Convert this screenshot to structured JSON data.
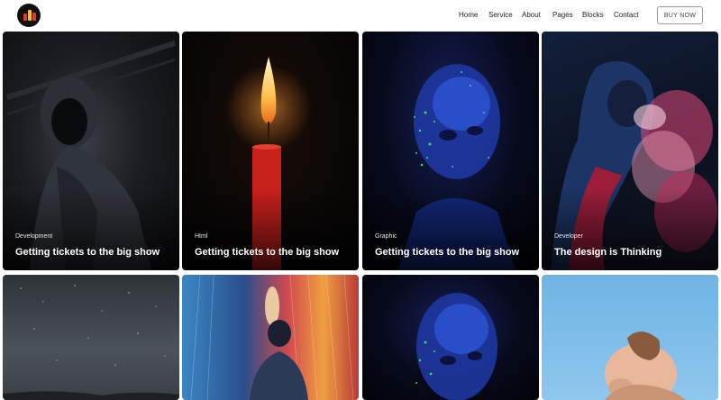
{
  "nav": {
    "items": [
      "Home",
      "Service",
      "About",
      "Pages",
      "Blocks",
      "Contact"
    ],
    "cta_label": "BUY NOW"
  },
  "cards": [
    {
      "category": "Development",
      "title": "Getting tickets to the big show"
    },
    {
      "category": "Html",
      "title": "Getting tickets to the big show"
    },
    {
      "category": "Graphic",
      "title": "Getting tickets to the big show"
    },
    {
      "category": "Developer",
      "title": "The design is Thinking"
    }
  ],
  "colors": {
    "logo_red": "#e23a2e",
    "logo_yellow": "#f5c518",
    "card_title": "#ffffff"
  }
}
